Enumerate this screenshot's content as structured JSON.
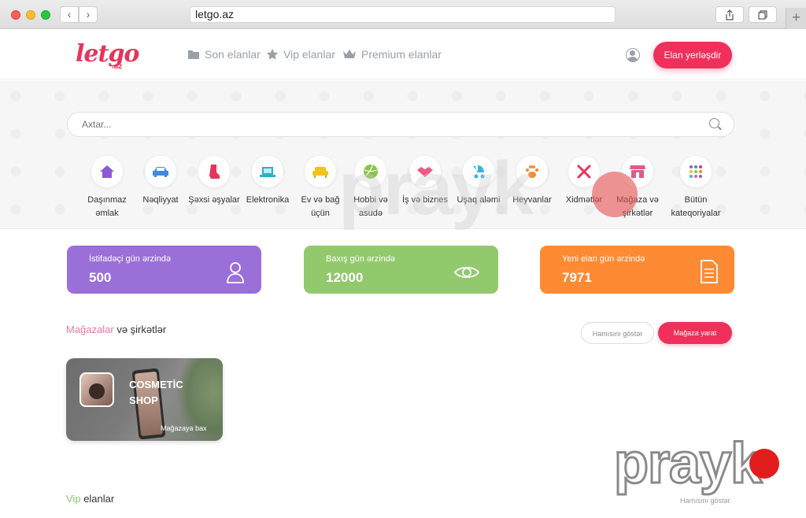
{
  "browser": {
    "url": "letgo.az",
    "back": "‹",
    "forward": "›",
    "new_tab": "+"
  },
  "header": {
    "logo": "letgo",
    "logo_sub": ".az",
    "nav": [
      {
        "label": "Son elanlar",
        "icon": "folder-icon"
      },
      {
        "label": "Vip elanlar",
        "icon": "star-icon"
      },
      {
        "label": "Premium elanlar",
        "icon": "crown-icon"
      }
    ],
    "post_button": "Elan yerləşdir",
    "accent": "#f0305a"
  },
  "search": {
    "placeholder": "Axtar..."
  },
  "categories": [
    {
      "label": "Daşınmaz əmlak",
      "icon": "house-icon",
      "color": "#8c5ad6"
    },
    {
      "label": "Nəqliyyat",
      "icon": "car-icon",
      "color": "#3e8be0"
    },
    {
      "label": "Şəxsi əşyalar",
      "icon": "boot-icon",
      "color": "#e8335a"
    },
    {
      "label": "Elektronika",
      "icon": "laptop-icon",
      "color": "#2fb0c9"
    },
    {
      "label": "Ev və bağ üçün",
      "icon": "sofa-icon",
      "color": "#f3c21b"
    },
    {
      "label": "Hobbi və asudə",
      "icon": "ball-icon",
      "color": "#8bc34a"
    },
    {
      "label": "İş və biznes",
      "icon": "handshake-icon",
      "color": "#f05a8a"
    },
    {
      "label": "Uşaq aləmi",
      "icon": "stroller-icon",
      "color": "#35b6e0"
    },
    {
      "label": "Heyvanlar",
      "icon": "paw-icon",
      "color": "#f58a2c"
    },
    {
      "label": "Xidmətlər",
      "icon": "tools-icon",
      "color": "#e8335a"
    },
    {
      "label": "Mağaza və şirkətlər",
      "icon": "store-icon",
      "color": "#e05a8a"
    },
    {
      "label": "Bütün kateqoriyalar",
      "icon": "grid-icon",
      "color": "#8c5ad6"
    }
  ],
  "stats": [
    {
      "label": "İstifadəçi gün ərzində",
      "value": "500",
      "icon": "user-icon",
      "color": "#9b6fd8"
    },
    {
      "label": "Baxış gün ərzində",
      "value": "12000",
      "icon": "eye-icon",
      "color": "#92c96c"
    },
    {
      "label": "Yeni elan gün ərzində",
      "value": "7971",
      "icon": "document-icon",
      "color": "#fe8a33"
    }
  ],
  "shops": {
    "title_accent": "Mağazalar",
    "title_rest": "və şirkətlər",
    "show_all": "Hamısını göstər",
    "create": "Mağaza yarat",
    "cards": [
      {
        "name_line1": "COSMETİC",
        "name_line2": "SHOP",
        "link": "Mağazaya bax"
      }
    ]
  },
  "vip": {
    "title_accent": "Vip",
    "title_rest": "elanlar",
    "show_all": "Hamısını göstər"
  },
  "watermark": {
    "text": "prayk"
  }
}
